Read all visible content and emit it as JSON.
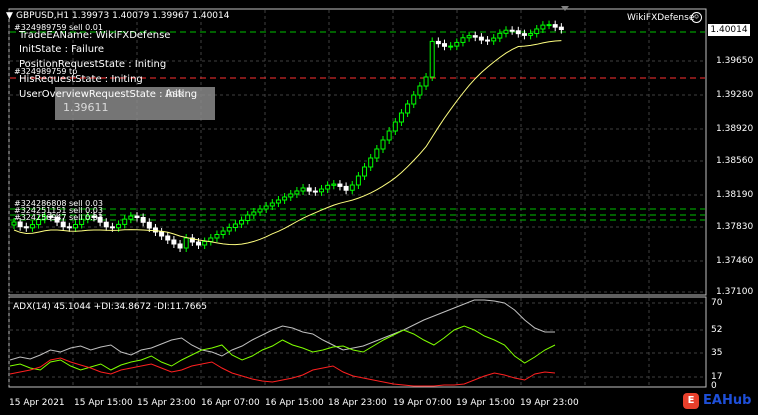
{
  "chart_header": {
    "symbol_info": "GBPUSD,H1  1.39973 1.40079 1.39967 1.40014",
    "ea_name": "WikiFXDefense"
  },
  "ea_status": {
    "order_tag_top": "#324989759 sell 0.01",
    "lines": [
      "TradeEAName: WikiFXDefense",
      "InitState : Failure",
      "PositionRequestState : Initing",
      "HisRequestState : Initing",
      "UserOverviewRequestState : Initing"
    ],
    "order_tag_mid": "#324989759 tp",
    "ask_tooltip_label": "Ask",
    "ask_tooltip_value": "1.39611"
  },
  "order_tags_lower": [
    "#324286808 sell 0.03",
    "#324251151 sell 0.03",
    "#324256947 sell 0.03"
  ],
  "price_axis": {
    "current_price": "1.40014",
    "ticks": [
      "1.39650",
      "1.39280",
      "1.38920",
      "1.38560",
      "1.38190",
      "1.37830",
      "1.37460",
      "1.37100"
    ]
  },
  "indicator": {
    "label": "ADX(14) 45.1044 +DI:34.8672 -DI:11.7665",
    "ticks": [
      "70",
      "52",
      "35",
      "17",
      "0"
    ]
  },
  "time_axis": {
    "ticks": [
      "15 Apr 2021",
      "15 Apr 15:00",
      "15 Apr 23:00",
      "16 Apr 07:00",
      "16 Apr 15:00",
      "18 Apr 23:00",
      "19 Apr 07:00",
      "19 Apr 15:00",
      "19 Apr 23:00"
    ]
  },
  "watermark": {
    "text": "EAHub",
    "logo_glyph": "E",
    "color": "#1e4fd8"
  },
  "colors": {
    "bull_candle": "#00ff00",
    "bear_candle": "#ffffff",
    "ma_line": "#ffff80",
    "adx_line": "#c0c0c0",
    "plus_di": "#7fff00",
    "minus_di": "#ff2020",
    "grid": "#404040",
    "order_line_green": "#00c000",
    "order_line_red": "#ff3030"
  }
}
